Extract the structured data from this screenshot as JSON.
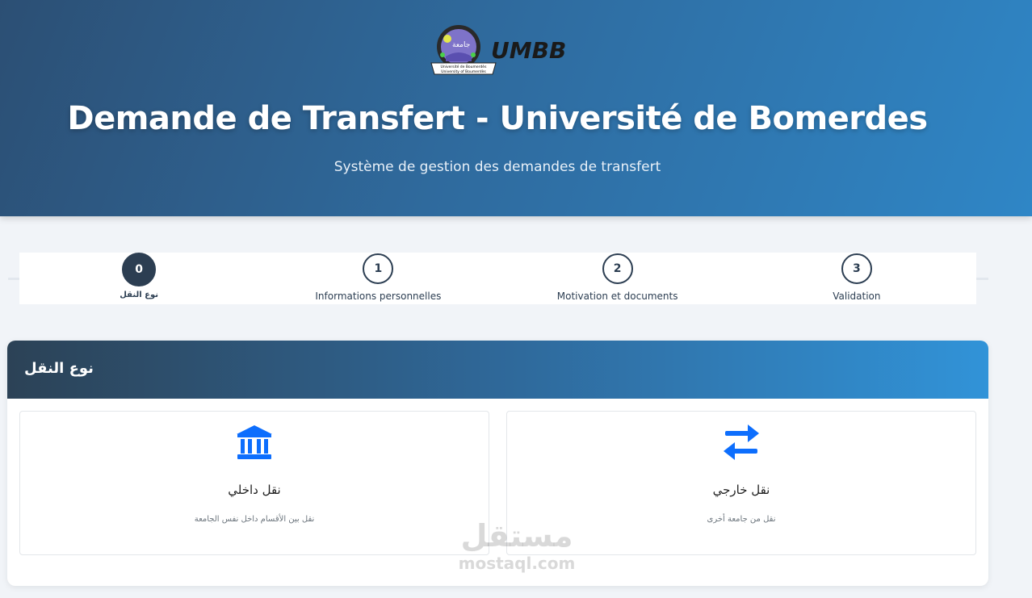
{
  "hero": {
    "logo_text": "UMBB",
    "logo_caption_1": "Université de Boumerdès",
    "logo_caption_2": "University of Boumerdès",
    "title": "Demande de Transfert - Université de Bomerdes",
    "subtitle": "Système de gestion des demandes de transfert"
  },
  "stepper": {
    "steps": [
      {
        "number": "0",
        "label": "نوع النقل",
        "active": true
      },
      {
        "number": "1",
        "label": "Informations personnelles",
        "active": false
      },
      {
        "number": "2",
        "label": "Motivation et documents",
        "active": false
      },
      {
        "number": "3",
        "label": "Validation",
        "active": false
      }
    ]
  },
  "transfer_type": {
    "title": "نوع النقل",
    "options": {
      "internal": {
        "title": "نقل داخلي",
        "description": "نقل بين الأقسام داخل نفس الجامعة",
        "icon": "bank-icon"
      },
      "external": {
        "title": "نقل خارجي",
        "description": "نقل من جامعة أخرى",
        "icon": "exchange-arrows-icon"
      }
    }
  },
  "watermark": {
    "arabic": "مستقل",
    "latin": "mostaql.com"
  },
  "colors": {
    "primary": "#2c3e52",
    "accent": "#0d6efd",
    "hero_start": "#2c4f74",
    "hero_end": "#2f86c6"
  }
}
